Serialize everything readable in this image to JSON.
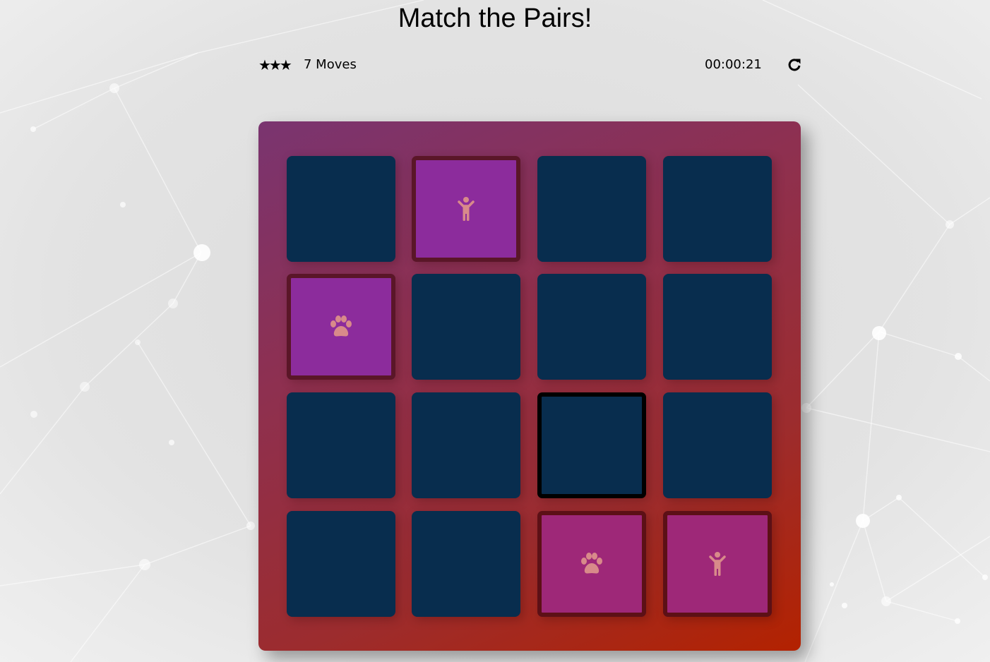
{
  "title": "Match the Pairs!",
  "score_panel": {
    "stars": "★★★",
    "star_count": 3,
    "moves_label": "7 Moves",
    "moves": 7,
    "timer": "00:00:21",
    "restart_icon": "refresh-icon"
  },
  "colors": {
    "card_hidden": "#082d4e",
    "card_open": "#8c2c9c",
    "card_match": "#9e2878",
    "icon_color": "#d88a8a",
    "deck_gradient_start": "#7a3470",
    "deck_gradient_end": "#b32200"
  },
  "deck": {
    "rows": 4,
    "columns": 4,
    "cards": [
      {
        "state": "hidden",
        "icon": ""
      },
      {
        "state": "open",
        "icon": "child-icon"
      },
      {
        "state": "hidden",
        "icon": ""
      },
      {
        "state": "hidden",
        "icon": ""
      },
      {
        "state": "open",
        "icon": "paw-icon"
      },
      {
        "state": "hidden",
        "icon": ""
      },
      {
        "state": "hidden",
        "icon": ""
      },
      {
        "state": "hidden",
        "icon": ""
      },
      {
        "state": "hidden",
        "icon": ""
      },
      {
        "state": "hidden",
        "icon": ""
      },
      {
        "state": "selected",
        "icon": ""
      },
      {
        "state": "hidden",
        "icon": ""
      },
      {
        "state": "hidden",
        "icon": ""
      },
      {
        "state": "hidden",
        "icon": ""
      },
      {
        "state": "match",
        "icon": "paw-icon"
      },
      {
        "state": "match",
        "icon": "child-icon"
      }
    ]
  }
}
